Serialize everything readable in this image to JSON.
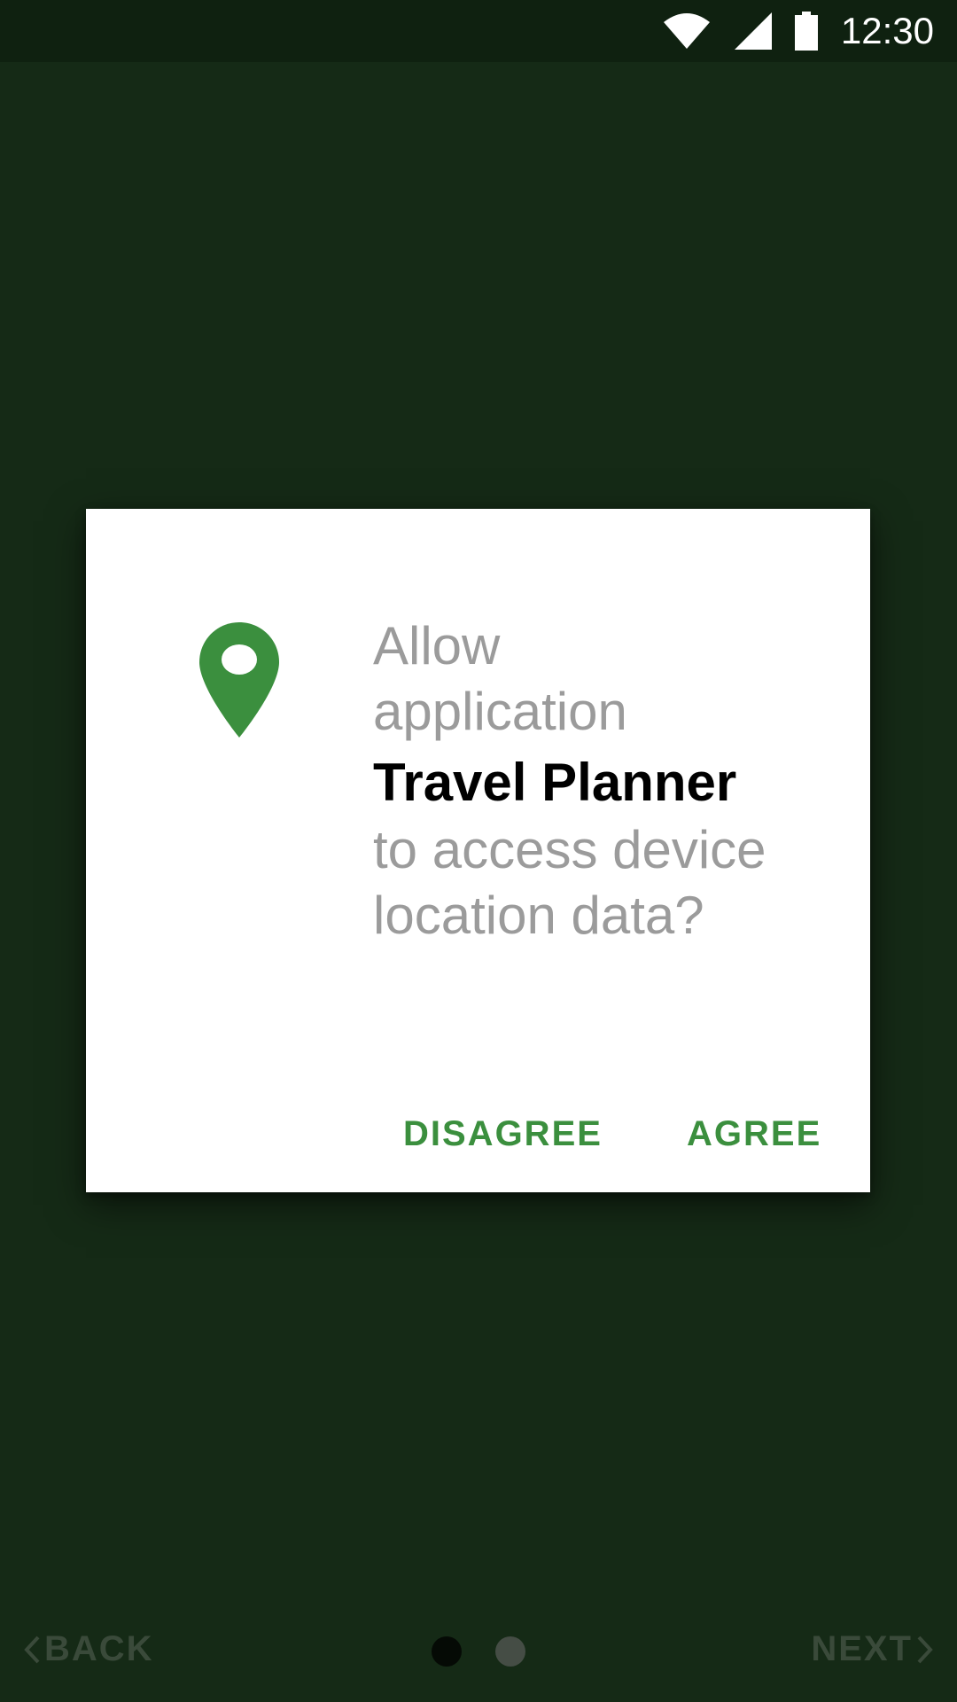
{
  "status_bar": {
    "time": "12:30",
    "icons": [
      "wifi-icon",
      "signal-icon",
      "battery-icon"
    ]
  },
  "dialog": {
    "icon": "location-pin-icon",
    "text_line1": "Allow",
    "text_line2": "application",
    "app_name": "Travel Planner",
    "text_line3": "to access device",
    "text_line4": "location data?",
    "disagree_label": "DISAGREE",
    "agree_label": "AGREE"
  },
  "bottom_nav": {
    "back_label": "BACK",
    "next_label": "NEXT",
    "page_count": 2,
    "current_page": 1
  },
  "colors": {
    "background": "#152a16",
    "status_bar": "#0f2110",
    "accent": "#3b8f3e",
    "dialog_text": "#9b9b9b"
  }
}
